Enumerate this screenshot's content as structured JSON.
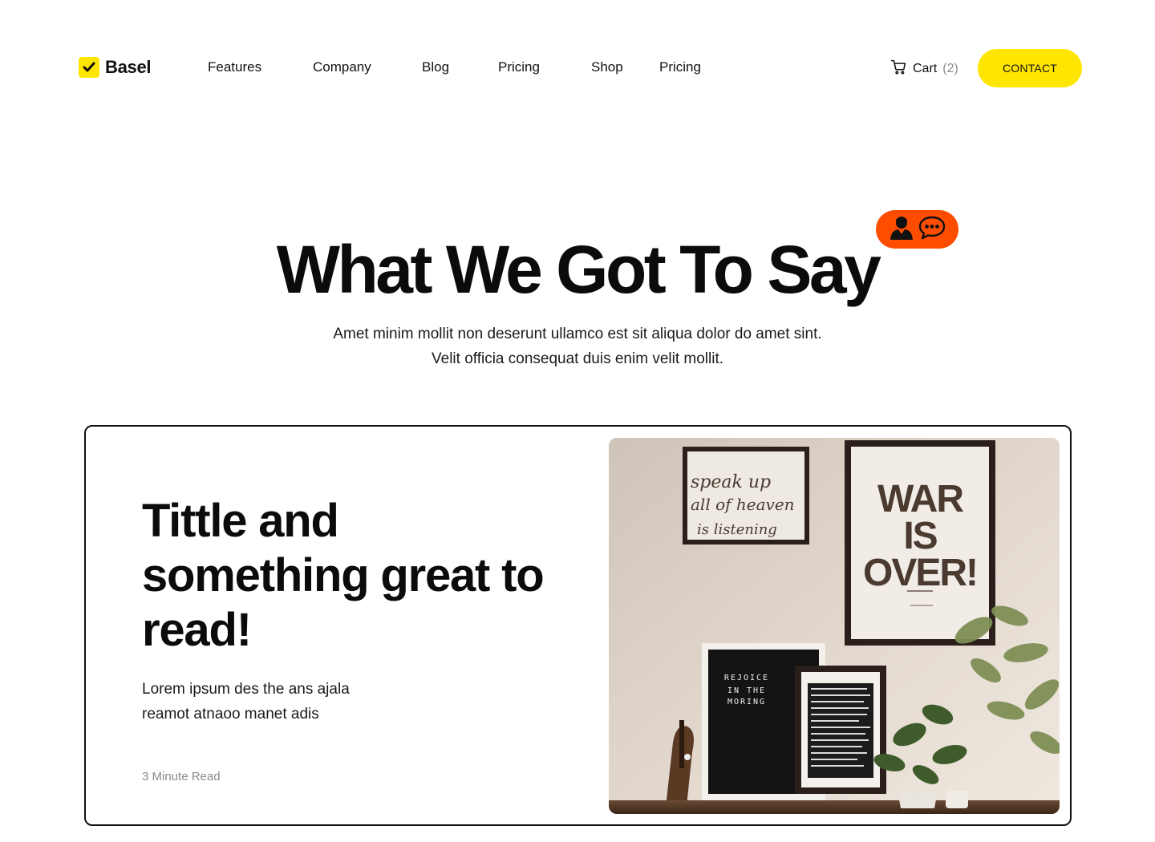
{
  "brand": {
    "name": "Basel",
    "accent": "#FFE600"
  },
  "nav": {
    "items": [
      {
        "label": "Features"
      },
      {
        "label": "Company"
      },
      {
        "label": "Blog"
      },
      {
        "label": "Pricing"
      },
      {
        "label": "Shop"
      },
      {
        "label": "Pricing"
      }
    ]
  },
  "cart": {
    "label": "Cart",
    "count": "(2)",
    "icon": "cart-icon"
  },
  "contact": {
    "label": "CONTACT"
  },
  "hero": {
    "title": "What We Got To Say",
    "subtitle_line1": "Amet minim mollit non deserunt ullamco est sit aliqua dolor do amet sint.",
    "subtitle_line2": "Velit officia consequat duis enim velit mollit.",
    "badge": {
      "icons": [
        "person-icon",
        "chat-bubble-icon"
      ],
      "color": "#FF4D00"
    }
  },
  "card": {
    "title": "Tittle and something great to read!",
    "description": "Lorem ipsum des the ans ajala reamot atnaoo manet adis",
    "meta": "3 Minute Read",
    "image": {
      "frame1_text": "speak up all of heaven is listening",
      "frame2_text": "WAR IS OVER!",
      "frame3_text": "REJOICE IN THE MORING"
    }
  }
}
